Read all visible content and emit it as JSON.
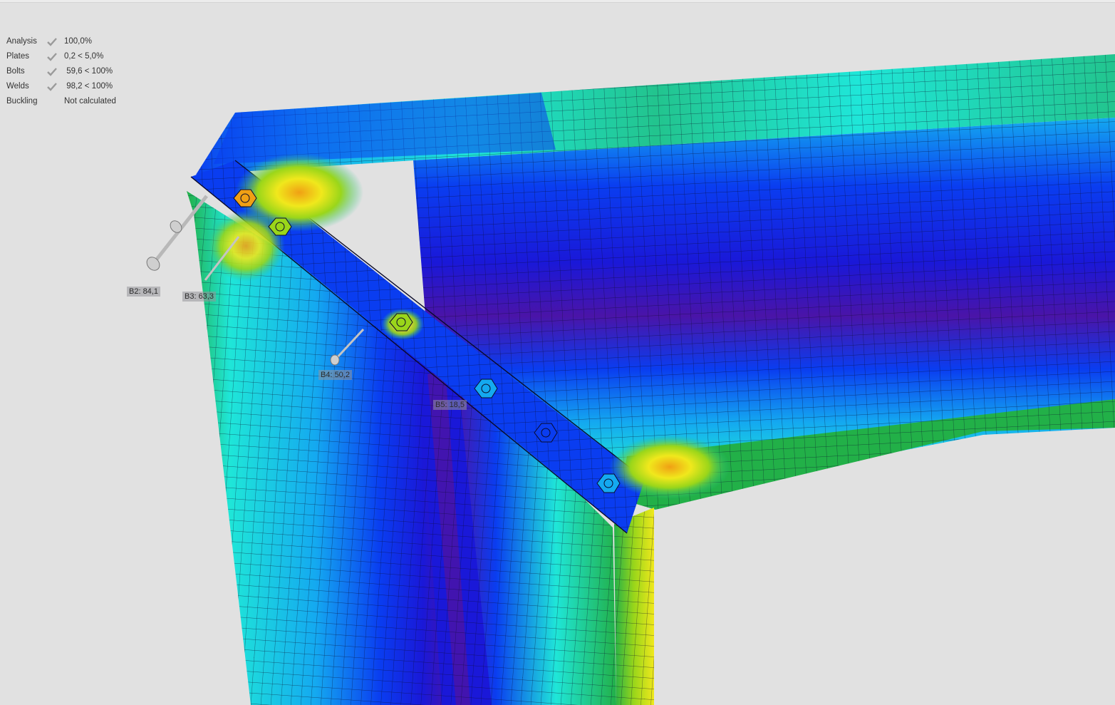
{
  "summary": {
    "rows": [
      {
        "label": "Analysis",
        "check_icon": "check-icon",
        "value": "100,0%"
      },
      {
        "label": "Plates",
        "check_icon": "check-icon",
        "value": "0,2 < 5,0%"
      },
      {
        "label": "Bolts",
        "check_icon": "check-icon",
        "value": " 59,6 < 100%"
      },
      {
        "label": "Welds",
        "check_icon": "check-icon",
        "value": " 98,2 < 100%"
      },
      {
        "label": "Buckling",
        "check_icon": "",
        "value": "Not calculated"
      }
    ]
  },
  "bolt_labels": [
    {
      "id": "B2",
      "text": "B2: 84,1"
    },
    {
      "id": "B3",
      "text": "B3: 63,3"
    },
    {
      "id": "B4",
      "text": "B4: 50,2"
    },
    {
      "id": "B5",
      "text": "B5: 18,5"
    }
  ],
  "colors": {
    "background": "#e1e1e1",
    "stress_purple": "#4a14a8",
    "stress_darkblue": "#1a18d8",
    "stress_blue": "#0a3df0",
    "stress_skyblue": "#14a9f0",
    "stress_cyan": "#1fe6d8",
    "stress_teal": "#22c48e",
    "stress_green": "#22b048",
    "stress_lime": "#9ad61a",
    "stress_yellow": "#f0e81c",
    "stress_orange": "#f0a014",
    "check_gray": "#9a9a9a"
  }
}
